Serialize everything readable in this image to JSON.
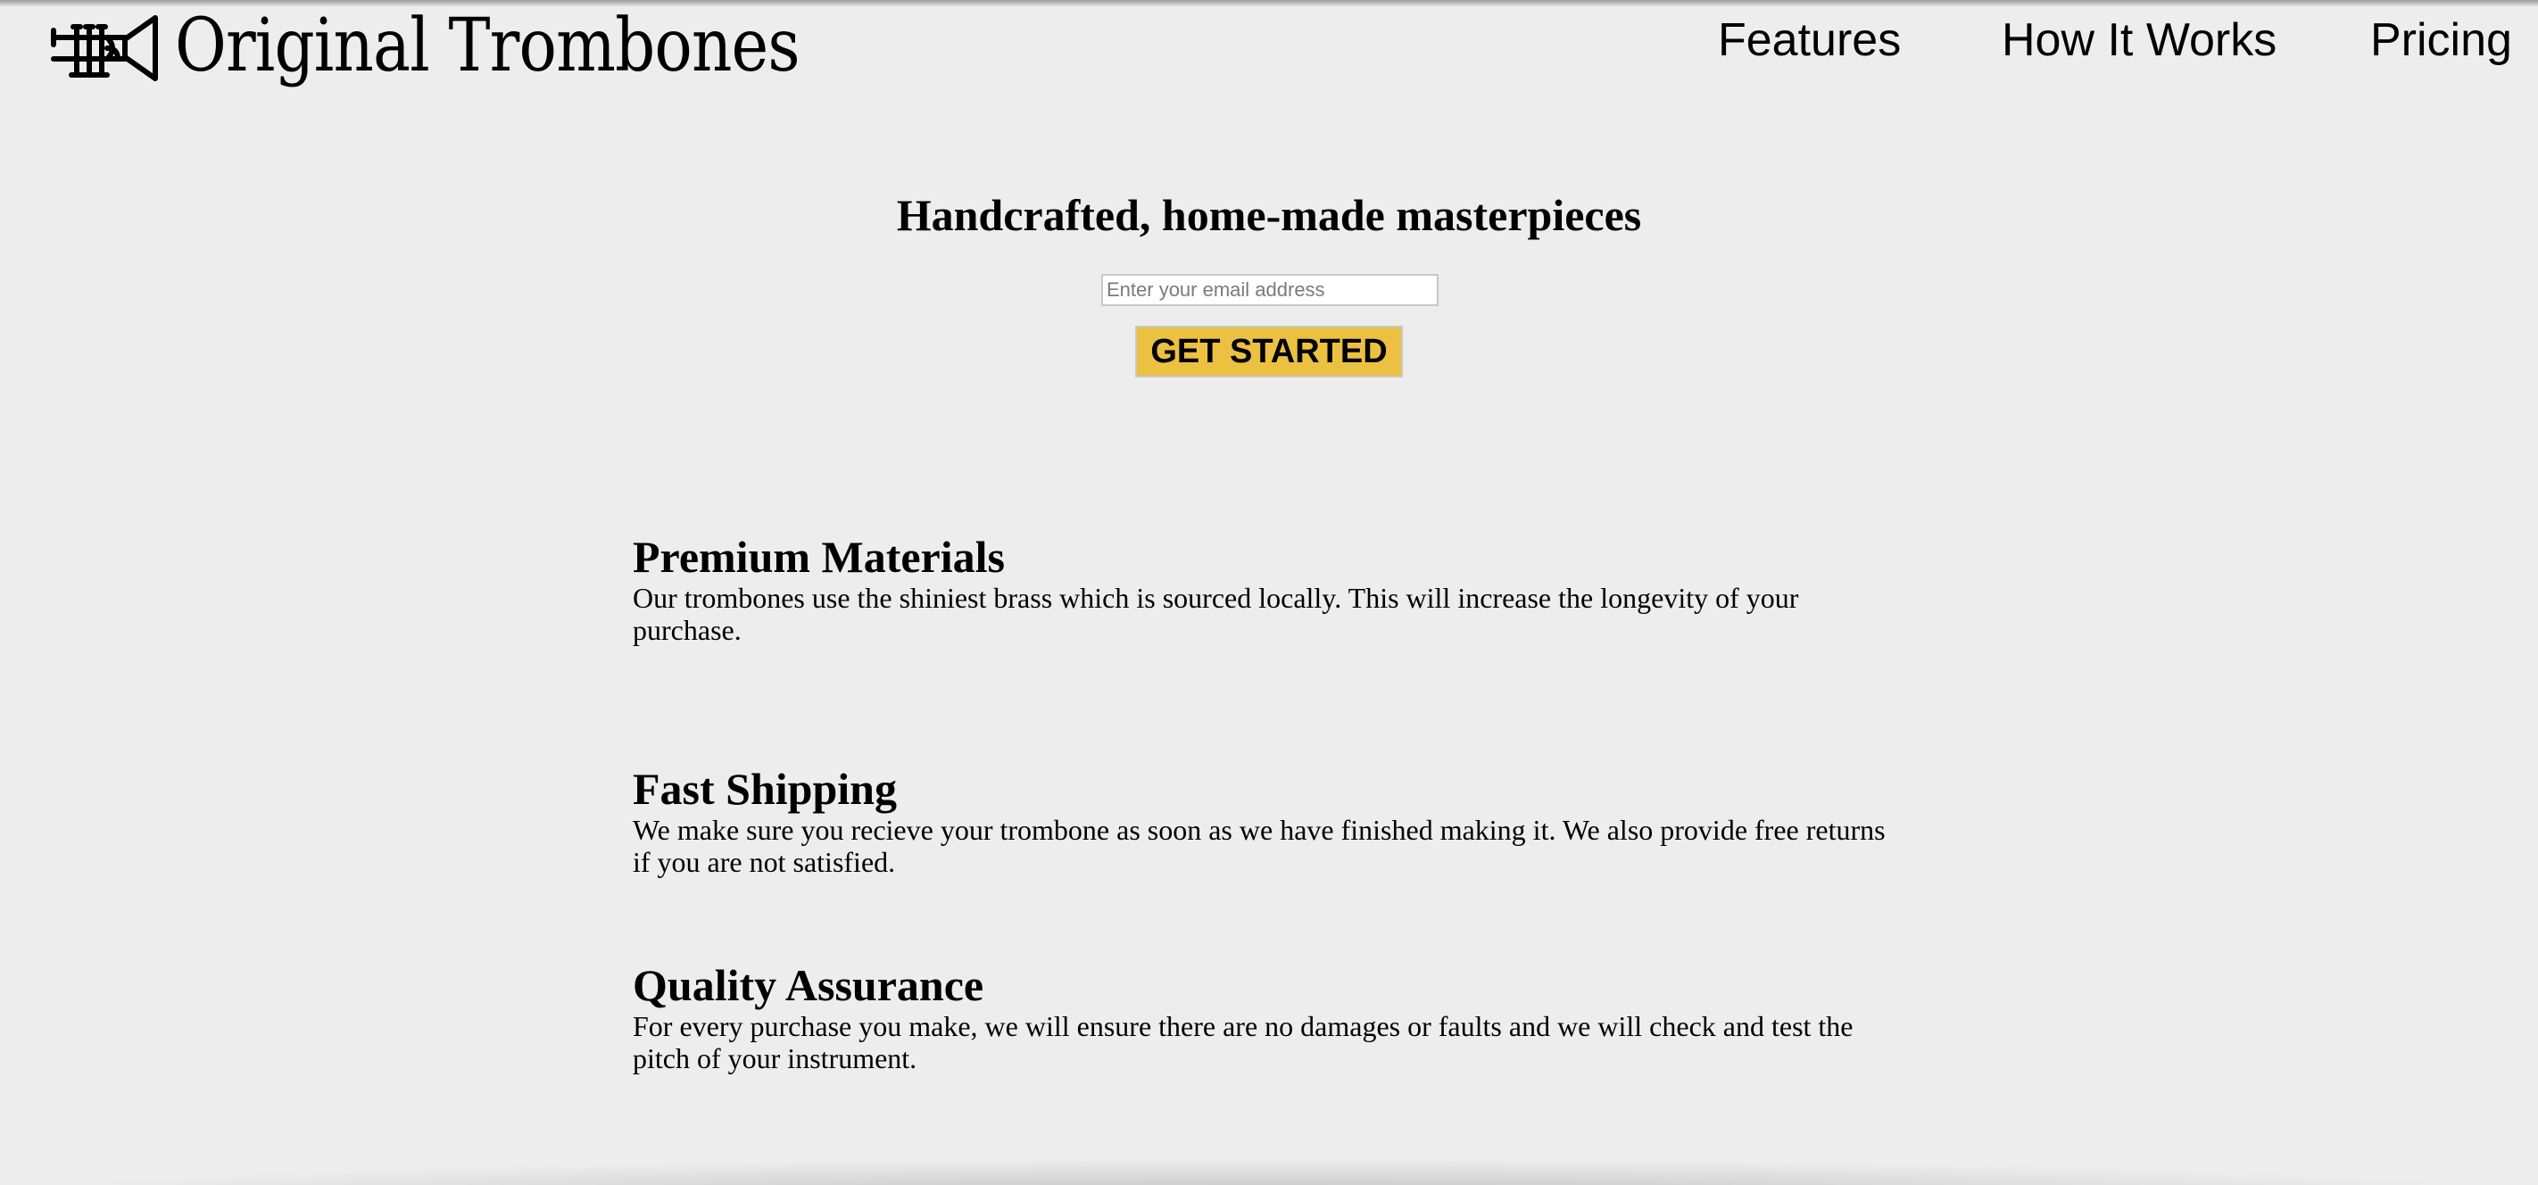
{
  "header": {
    "brand": "Original Trombones",
    "logo_icon": "trombone-icon",
    "nav": [
      {
        "label": "Features"
      },
      {
        "label": "How It Works"
      },
      {
        "label": "Pricing"
      }
    ]
  },
  "hero": {
    "title": "Handcrafted, home-made masterpieces",
    "email_placeholder": "Enter your email address",
    "email_value": "",
    "cta_label": "GET STARTED",
    "cta_color": "#ecc141"
  },
  "features": [
    {
      "title": "Premium Materials",
      "text": "Our trombones use the shiniest brass which is sourced locally. This will increase the longevity of your purchase."
    },
    {
      "title": "Fast Shipping",
      "text": "We make sure you recieve your trombone as soon as we have finished making it. We also provide free returns if you are not satisfied."
    },
    {
      "title": "Quality Assurance",
      "text": "For every purchase you make, we will ensure there are no damages or faults and we will check and test the pitch of your instrument."
    }
  ],
  "colors": {
    "background": "#ededed",
    "text": "#000000"
  }
}
